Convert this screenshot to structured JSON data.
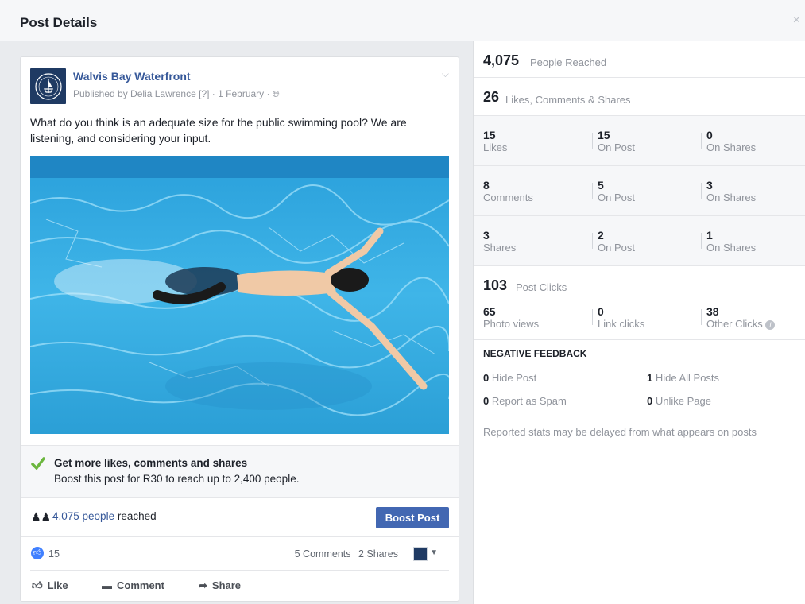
{
  "modal": {
    "title": "Post Details",
    "close": "×"
  },
  "post": {
    "page_name": "Walvis Bay Waterfront",
    "published_by": "Published by Delia Lawrence",
    "help_marker": "[?]",
    "date": "1 February",
    "text": "What do you think is an adequate size for the public swimming pool? We are listening, and considering your input.",
    "icons": {
      "avatar": "walvis-bay-logo",
      "globe": "globe-icon",
      "options": "chevron-down-icon"
    }
  },
  "boost": {
    "title": "Get more likes, comments and shares",
    "subtitle": "Boost this post for R30 to reach up to 2,400 people.",
    "check_color": "#6bb63e"
  },
  "reach": {
    "people_link": "4,075 people",
    "suffix": " reached",
    "button": "Boost Post"
  },
  "reactions": {
    "likes": "15",
    "comments": "5 Comments",
    "shares": "2 Shares"
  },
  "actions": {
    "like": "Like",
    "comment": "Comment",
    "share": "Share"
  },
  "stats": {
    "reached_num": "4,075",
    "reached_label": "People Reached",
    "engagement_num": "26",
    "engagement_label": "Likes, Comments & Shares",
    "rows": [
      [
        {
          "n": "15",
          "l": "Likes"
        },
        {
          "n": "15",
          "l": "On Post"
        },
        {
          "n": "0",
          "l": "On Shares"
        }
      ],
      [
        {
          "n": "8",
          "l": "Comments"
        },
        {
          "n": "5",
          "l": "On Post"
        },
        {
          "n": "3",
          "l": "On Shares"
        }
      ],
      [
        {
          "n": "3",
          "l": "Shares"
        },
        {
          "n": "2",
          "l": "On Post"
        },
        {
          "n": "1",
          "l": "On Shares"
        }
      ]
    ],
    "clicks_num": "103",
    "clicks_label": "Post Clicks",
    "clicks": [
      {
        "n": "65",
        "l": "Photo views"
      },
      {
        "n": "0",
        "l": "Link clicks"
      },
      {
        "n": "38",
        "l": "Other Clicks"
      }
    ],
    "negative": {
      "title": "NEGATIVE FEEDBACK",
      "hide_post_n": "0",
      "hide_post_l": " Hide Post",
      "hide_all_n": "1",
      "hide_all_l": " Hide All Posts",
      "spam_n": "0",
      "spam_l": " Report as Spam",
      "unlike_n": "0",
      "unlike_l": " Unlike Page"
    },
    "note": "Reported stats may be delayed from what appears on posts"
  }
}
